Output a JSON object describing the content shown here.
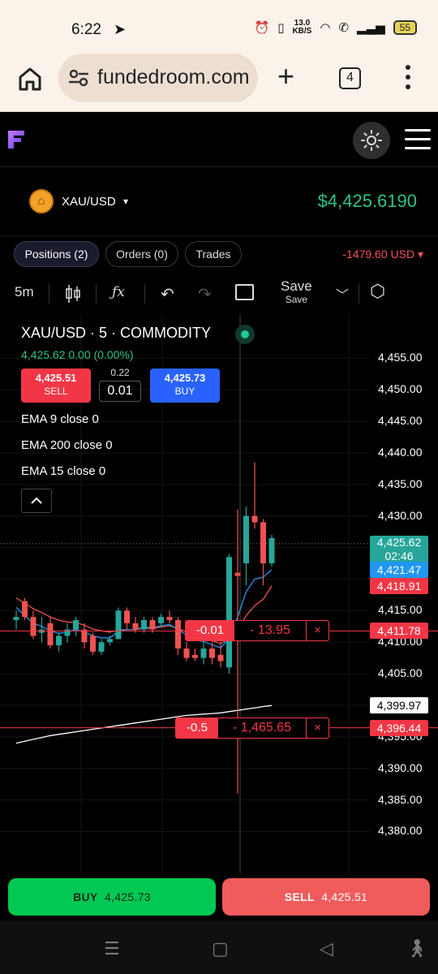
{
  "status_bar": {
    "time": "6:22",
    "net_speed_value": "13.0",
    "net_speed_unit": "KB/S",
    "battery": "55"
  },
  "browser": {
    "url": "fundedroom.com",
    "tab_count": "4"
  },
  "symbol": {
    "name": "XAU/USD",
    "caret": "▾",
    "price": "$4,425.6190"
  },
  "tabs": [
    {
      "label": "Positions (2)",
      "active": true
    },
    {
      "label": "Orders (0)",
      "active": false
    },
    {
      "label": "Trades",
      "active": false
    }
  ],
  "pnl": "-1479.60 USD",
  "pnl_caret": "▾",
  "toolbar": {
    "interval": "5m",
    "save_label": "Save",
    "save_sub": "Save"
  },
  "legend": {
    "title": "XAU/USD · 5 · COMMODITY",
    "last": "4,425.62  0.00 (0.00%)",
    "sell_price": "4,425.51",
    "sell_label": "SELL",
    "spread": "0.22",
    "lot": "0.01",
    "buy_price": "4,425.73",
    "buy_label": "BUY",
    "ema": [
      "EMA 9 close 0",
      "EMA 200 close 0",
      "EMA 15 close 0"
    ]
  },
  "axis_labels": [
    "4,455.00",
    "4,450.00",
    "4,445.00",
    "4,440.00",
    "4,435.00",
    "4,430.00",
    "4,425.00",
    "4,420.00",
    "4,415.00",
    "4,410.00",
    "4,405.00",
    "4,400.00",
    "4,395.00",
    "4,390.00",
    "4,385.00",
    "4,380.00"
  ],
  "price_tags": [
    {
      "text": "4,425.62",
      "sub": "02:46",
      "price": 4425.62,
      "bg": "#26a69a",
      "fg": "#ffffff"
    },
    {
      "text": "4,421.47",
      "price": 4421.47,
      "bg": "#2196f3",
      "fg": "#ffffff"
    },
    {
      "text": "4,418.91",
      "price": 4418.91,
      "bg": "#f23645",
      "fg": "#ffffff"
    },
    {
      "text": "4,411.78",
      "price": 4411.78,
      "bg": "#f23645",
      "fg": "#ffffff"
    },
    {
      "text": "4,399.97",
      "price": 4399.97,
      "bg": "#ffffff",
      "fg": "#000000"
    },
    {
      "text": "4,396.44",
      "price": 4396.44,
      "bg": "#f23645",
      "fg": "#ffffff"
    }
  ],
  "positions": [
    {
      "qty": "-0.01",
      "pl": "- 13.95",
      "close": "×",
      "price": 4411.78
    },
    {
      "qty": "-0.5",
      "pl": "- 1,465.65",
      "close": "×",
      "price": 4396.44
    }
  ],
  "bottom": {
    "buy_label": "BUY",
    "buy_price": "4,425.73",
    "sell_label": "SELL",
    "sell_price": "4,425.51"
  },
  "colors": {
    "up": "#26a69a",
    "down": "#ef5350",
    "accent_green": "#2ec28a",
    "buy_blue": "#2962ff",
    "sell_red": "#f23645"
  },
  "chart_data": {
    "type": "candlestick",
    "symbol": "XAU/USD",
    "interval": "5",
    "ylim": [
      4378,
      4458
    ],
    "candles": [
      {
        "o": 4413.5,
        "h": 4415.0,
        "l": 4412.0,
        "c": 4414.0
      },
      {
        "o": 4416.5,
        "h": 4417.0,
        "l": 4413.5,
        "c": 4414.0
      },
      {
        "o": 4414.0,
        "h": 4415.0,
        "l": 4410.5,
        "c": 4411.0
      },
      {
        "o": 4411.5,
        "h": 4414.0,
        "l": 4410.0,
        "c": 4412.0
      },
      {
        "o": 4413.0,
        "h": 4414.0,
        "l": 4409.0,
        "c": 4409.5
      },
      {
        "o": 4409.5,
        "h": 4411.5,
        "l": 4408.5,
        "c": 4411.0
      },
      {
        "o": 4411.0,
        "h": 4413.0,
        "l": 4410.0,
        "c": 4412.0
      },
      {
        "o": 4412.0,
        "h": 4414.0,
        "l": 4411.0,
        "c": 4413.5
      },
      {
        "o": 4412.0,
        "h": 4413.0,
        "l": 4409.0,
        "c": 4410.0
      },
      {
        "o": 4411.0,
        "h": 4411.5,
        "l": 4408.0,
        "c": 4408.5
      },
      {
        "o": 4408.5,
        "h": 4410.5,
        "l": 4408.0,
        "c": 4410.0
      },
      {
        "o": 4410.0,
        "h": 4411.0,
        "l": 4409.5,
        "c": 4410.5
      },
      {
        "o": 4410.5,
        "h": 4415.5,
        "l": 4410.5,
        "c": 4415.0
      },
      {
        "o": 4415.0,
        "h": 4415.5,
        "l": 4412.0,
        "c": 4413.0
      },
      {
        "o": 4413.0,
        "h": 4414.0,
        "l": 4411.5,
        "c": 4412.0
      },
      {
        "o": 4412.0,
        "h": 4414.0,
        "l": 4411.5,
        "c": 4413.5
      },
      {
        "o": 4413.5,
        "h": 4414.0,
        "l": 4411.5,
        "c": 4412.0
      },
      {
        "o": 4413.0,
        "h": 4414.5,
        "l": 4412.5,
        "c": 4414.0
      },
      {
        "o": 4414.0,
        "h": 4415.0,
        "l": 4413.0,
        "c": 4413.5
      },
      {
        "o": 4413.5,
        "h": 4414.0,
        "l": 4408.0,
        "c": 4409.0
      },
      {
        "o": 4409.0,
        "h": 4410.0,
        "l": 4407.0,
        "c": 4407.5
      },
      {
        "o": 4408.0,
        "h": 4409.0,
        "l": 4407.0,
        "c": 4407.5
      },
      {
        "o": 4407.5,
        "h": 4410.0,
        "l": 4406.5,
        "c": 4409.0
      },
      {
        "o": 4409.0,
        "h": 4410.0,
        "l": 4406.5,
        "c": 4407.5
      },
      {
        "o": 4408.0,
        "h": 4410.0,
        "l": 4406.0,
        "c": 4407.0
      },
      {
        "o": 4406.0,
        "h": 4424.0,
        "l": 4405.0,
        "c": 4423.5
      },
      {
        "o": 4421.0,
        "h": 4431.0,
        "l": 4386.0,
        "c": 4420.5
      },
      {
        "o": 4422.5,
        "h": 4431.5,
        "l": 4419.0,
        "c": 4430.0
      },
      {
        "o": 4430.0,
        "h": 4438.5,
        "l": 4428.0,
        "c": 4429.0
      },
      {
        "o": 4429.0,
        "h": 4429.5,
        "l": 4419.0,
        "c": 4422.5
      },
      {
        "o": 4422.5,
        "h": 4427.0,
        "l": 4422.0,
        "c": 4426.5
      }
    ],
    "ema_fast": [
      4415.5,
      4414.2,
      4413.0,
      4412.5,
      4411.8,
      4411.4,
      4411.6,
      4412.0,
      4411.6,
      4411.0,
      4410.7,
      4410.7,
      4411.7,
      4412.0,
      4412.0,
      4412.4,
      4412.3,
      4412.6,
      4412.8,
      4412.0,
      4411.1,
      4410.4,
      4410.1,
      4409.6,
      4409.1,
      4410.6,
      4414.0,
      4418.0,
      4420.0,
      4420.3,
      4421.5
    ],
    "ema_mid": [
      4417.0,
      4416.2,
      4415.3,
      4414.7,
      4414.0,
      4413.5,
      4413.2,
      4413.1,
      4412.7,
      4412.1,
      4411.8,
      4411.6,
      4411.9,
      4412.0,
      4412.0,
      4412.2,
      4412.2,
      4412.4,
      4412.6,
      4412.2,
      4411.6,
      4411.0,
      4410.6,
      4410.2,
      4409.8,
      4410.5,
      4412.0,
      4414.2,
      4415.8,
      4416.8,
      4418.9
    ],
    "ema_slow": [
      4394.0,
      4394.3,
      4394.6,
      4394.9,
      4395.2,
      4395.4,
      4395.6,
      4395.8,
      4396.0,
      4396.2,
      4396.4,
      4396.6,
      4396.8,
      4397.0,
      4397.2,
      4397.4,
      4397.6,
      4397.8,
      4398.0,
      4398.2,
      4398.4,
      4398.5,
      4398.6,
      4398.7,
      4398.8,
      4399.0,
      4399.2,
      4399.4,
      4399.6,
      4399.8,
      4399.97
    ]
  }
}
